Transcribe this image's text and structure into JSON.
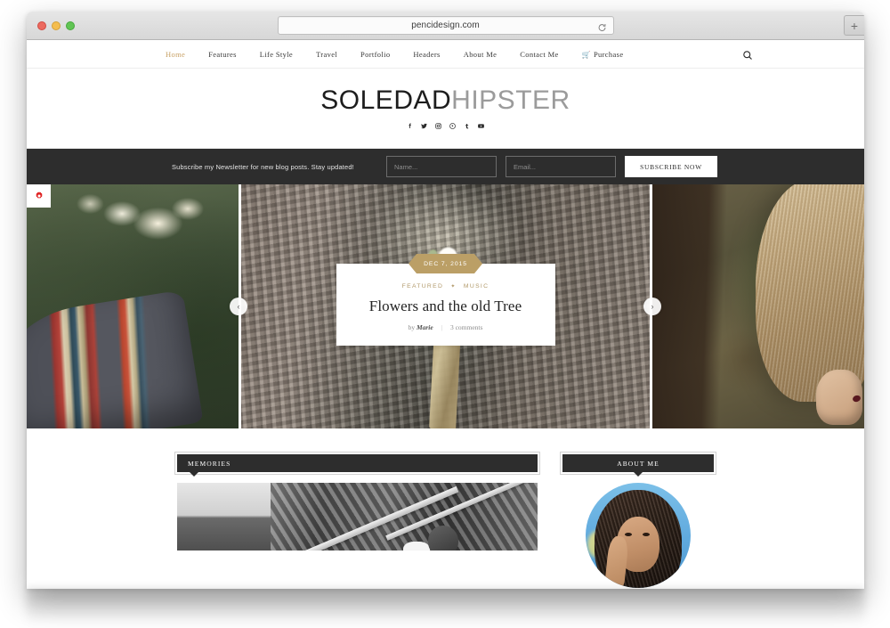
{
  "browser": {
    "url": "pencidesign.com",
    "reload_icon": "reload-icon",
    "new_tab_label": "+",
    "traffic_lights": [
      "close",
      "minimize",
      "maximize"
    ]
  },
  "nav": {
    "items": [
      {
        "label": "Home",
        "active": true
      },
      {
        "label": "Features",
        "active": false
      },
      {
        "label": "Life Style",
        "active": false
      },
      {
        "label": "Travel",
        "active": false
      },
      {
        "label": "Portfolio",
        "active": false
      },
      {
        "label": "Headers",
        "active": false
      },
      {
        "label": "About Me",
        "active": false
      },
      {
        "label": "Contact Me",
        "active": false
      },
      {
        "label": "Purchase",
        "active": false,
        "icon": "cart-icon"
      }
    ],
    "search_icon": "search-icon"
  },
  "header": {
    "logo_bold": "SOLEDAD",
    "logo_light": "HIPSTER",
    "social": [
      {
        "name": "facebook-icon",
        "glyph": "f"
      },
      {
        "name": "twitter-icon",
        "glyph": "t"
      },
      {
        "name": "instagram-icon",
        "glyph": "i"
      },
      {
        "name": "pinterest-icon",
        "glyph": "p"
      },
      {
        "name": "tumblr-icon",
        "glyph": "t"
      },
      {
        "name": "youtube-icon",
        "glyph": "y"
      }
    ]
  },
  "newsletter": {
    "text": "Subscribe my Newsletter for new blog posts. Stay updated!",
    "name_placeholder": "Name...",
    "name_value": "",
    "email_placeholder": "Email...",
    "email_value": "",
    "submit_label": "SUBSCRIBE NOW",
    "background_color": "#2d2d2d"
  },
  "slider": {
    "gear_icon": "gear-icon",
    "gear_color": "#e02626",
    "prev_label": "‹",
    "next_label": "›",
    "featured": {
      "date": "DEC 7, 2015",
      "date_badge_color": "#bb9f66",
      "categories": [
        "FEATURED",
        "MUSIC"
      ],
      "category_separator": "✦",
      "title": "Flowers and the old Tree",
      "author_prefix": "by",
      "author": "Marie",
      "meta_divider": "|",
      "comments": "3 comments"
    },
    "slides": [
      {
        "alt": "green foliage with striped blanket"
      },
      {
        "alt": "tree bark with white flower bouquet"
      },
      {
        "alt": "forest tree trunk with blonde hair"
      }
    ]
  },
  "sections": {
    "memories": {
      "title": "MEMORIES",
      "pointer": "left",
      "photo_alt": "black and white photo of stairs and a woman"
    },
    "about_me": {
      "title": "ABOUT ME",
      "pointer": "center",
      "avatar_alt": "portrait of a curly haired woman against blue sky"
    }
  }
}
